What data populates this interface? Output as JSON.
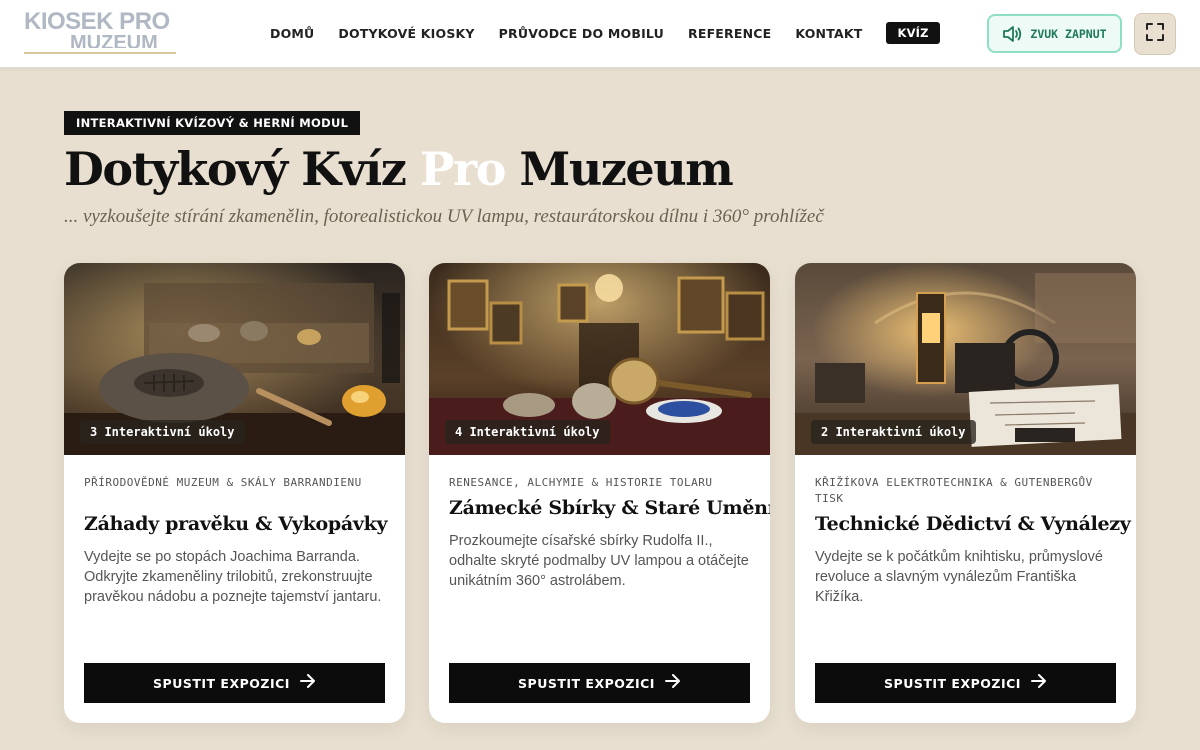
{
  "header": {
    "logo_line1": "KIOSEK PRO",
    "logo_line2": "MUZEUM",
    "nav": [
      "DOMŮ",
      "DOTYKOVÉ KIOSKY",
      "PRŮVODCE DO MOBILU",
      "REFERENCE",
      "KONTAKT"
    ],
    "nav_active": "KVÍZ",
    "sound_label": "ZVUK ZAPNUT",
    "sound_icon": "speaker-icon",
    "fullscreen_icon": "fullscreen-icon",
    "colors": {
      "sound_border": "#8fe0c2",
      "sound_text": "#1e7a5a"
    }
  },
  "hero": {
    "badge": "INTERAKTIVNÍ KVÍZOVÝ & HERNÍ MODUL",
    "title_part1": "Dotykový Kvíz ",
    "title_accent": "Pro",
    "title_part2": " Muzeum",
    "subtitle": "... vyzkoušejte stírání zkamenělin, fotorealistickou UV lampu, restaurátorskou dílnu i 360° prohlížeč"
  },
  "cards": [
    {
      "tasks": "3 Interaktivní úkoly",
      "category": "PŘÍRODOVĚDNÉ MUZEUM & SKÁLY BARRANDIENU",
      "title": "Záhady pravěku & Vykopávky",
      "description": "Vydejte se po stopách Joachima Barranda. Odkryjte zkameněliny trilobitů, zrekonstruujte pravěkou nádobu a poznejte tajemství jantaru.",
      "button": "SPUSTIT EXPOZICI"
    },
    {
      "tasks": "4 Interaktivní úkoly",
      "category": "RENESANCE, ALCHYMIE & HISTORIE TOLARU",
      "title": "Zámecké Sbírky & Staré Umění",
      "description": "Prozkoumejte císařské sbírky Rudolfa II., odhalte skryté podmalby UV lampou a otáčejte unikátním 360° astrolábem.",
      "button": "SPUSTIT EXPOZICI"
    },
    {
      "tasks": "2 Interaktivní úkoly",
      "category": "KŘIŽÍKOVA ELEKTROTECHNIKA & GUTENBERGŮV TISK",
      "title": "Technické Dědictví & Vynálezy",
      "description": "Vydejte se k počátkům knihtisku, průmyslové revoluce a slavným vynálezům Františka Křižíka.",
      "button": "SPUSTIT EXPOZICI"
    }
  ],
  "colors": {
    "page_bg": "#e8dfd0",
    "button_bg": "#0c0c0c"
  }
}
